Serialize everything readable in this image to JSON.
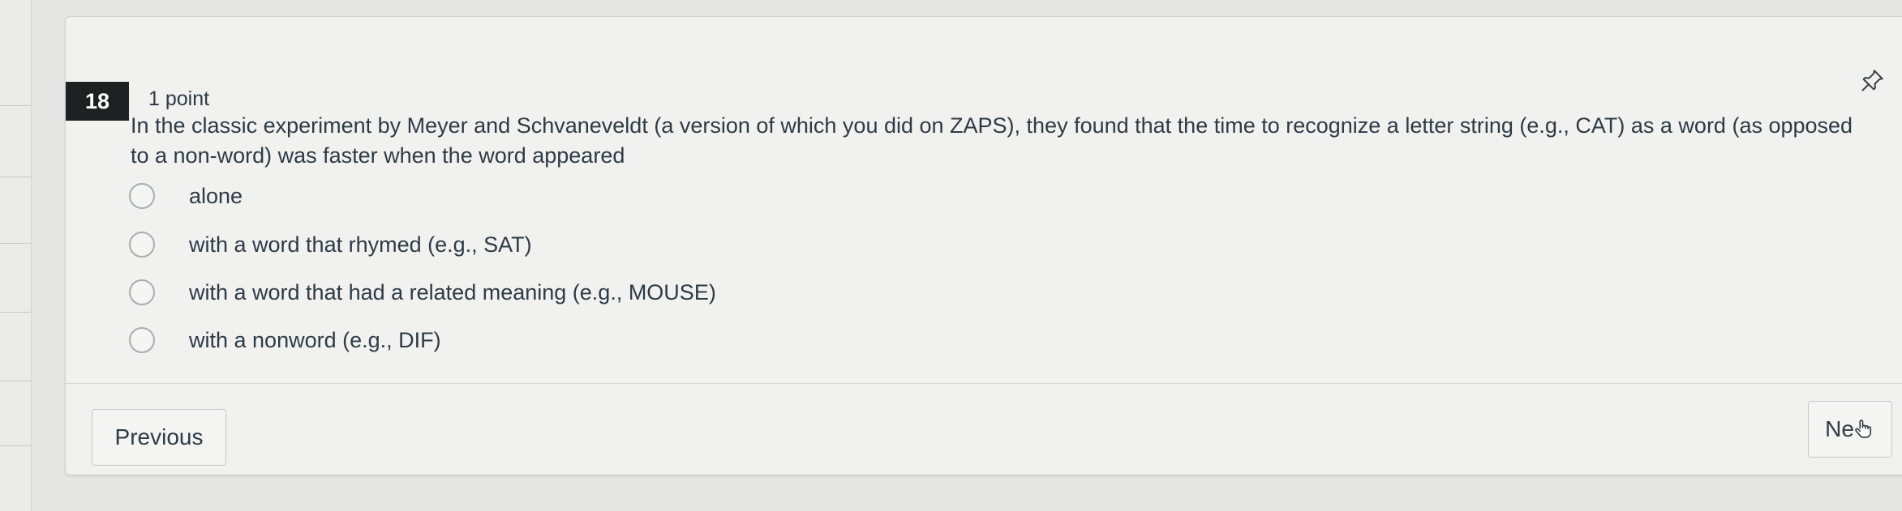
{
  "question": {
    "number": "18",
    "points": "1 point",
    "text": "In the classic experiment by Meyer and Schvaneveldt (a version of which you did on ZAPS), they found that the time to recognize a letter string (e.g., CAT) as a word (as opposed to a non-word) was faster when the word appeared",
    "options": [
      {
        "label": "alone"
      },
      {
        "label": "with a word that rhymed (e.g., SAT)"
      },
      {
        "label": "with a word that had a related meaning (e.g., MOUSE)"
      },
      {
        "label": "with a nonword (e.g., DIF)"
      }
    ],
    "pin_icon": "pin-icon"
  },
  "navigation": {
    "previous_label": "Previous",
    "next_label": "Ne",
    "cursor_icon": "hand-pointer-icon"
  },
  "colors": {
    "question_badge": "#1e2022",
    "text": "#2d3b45",
    "card_background": "#f1f1f0"
  }
}
